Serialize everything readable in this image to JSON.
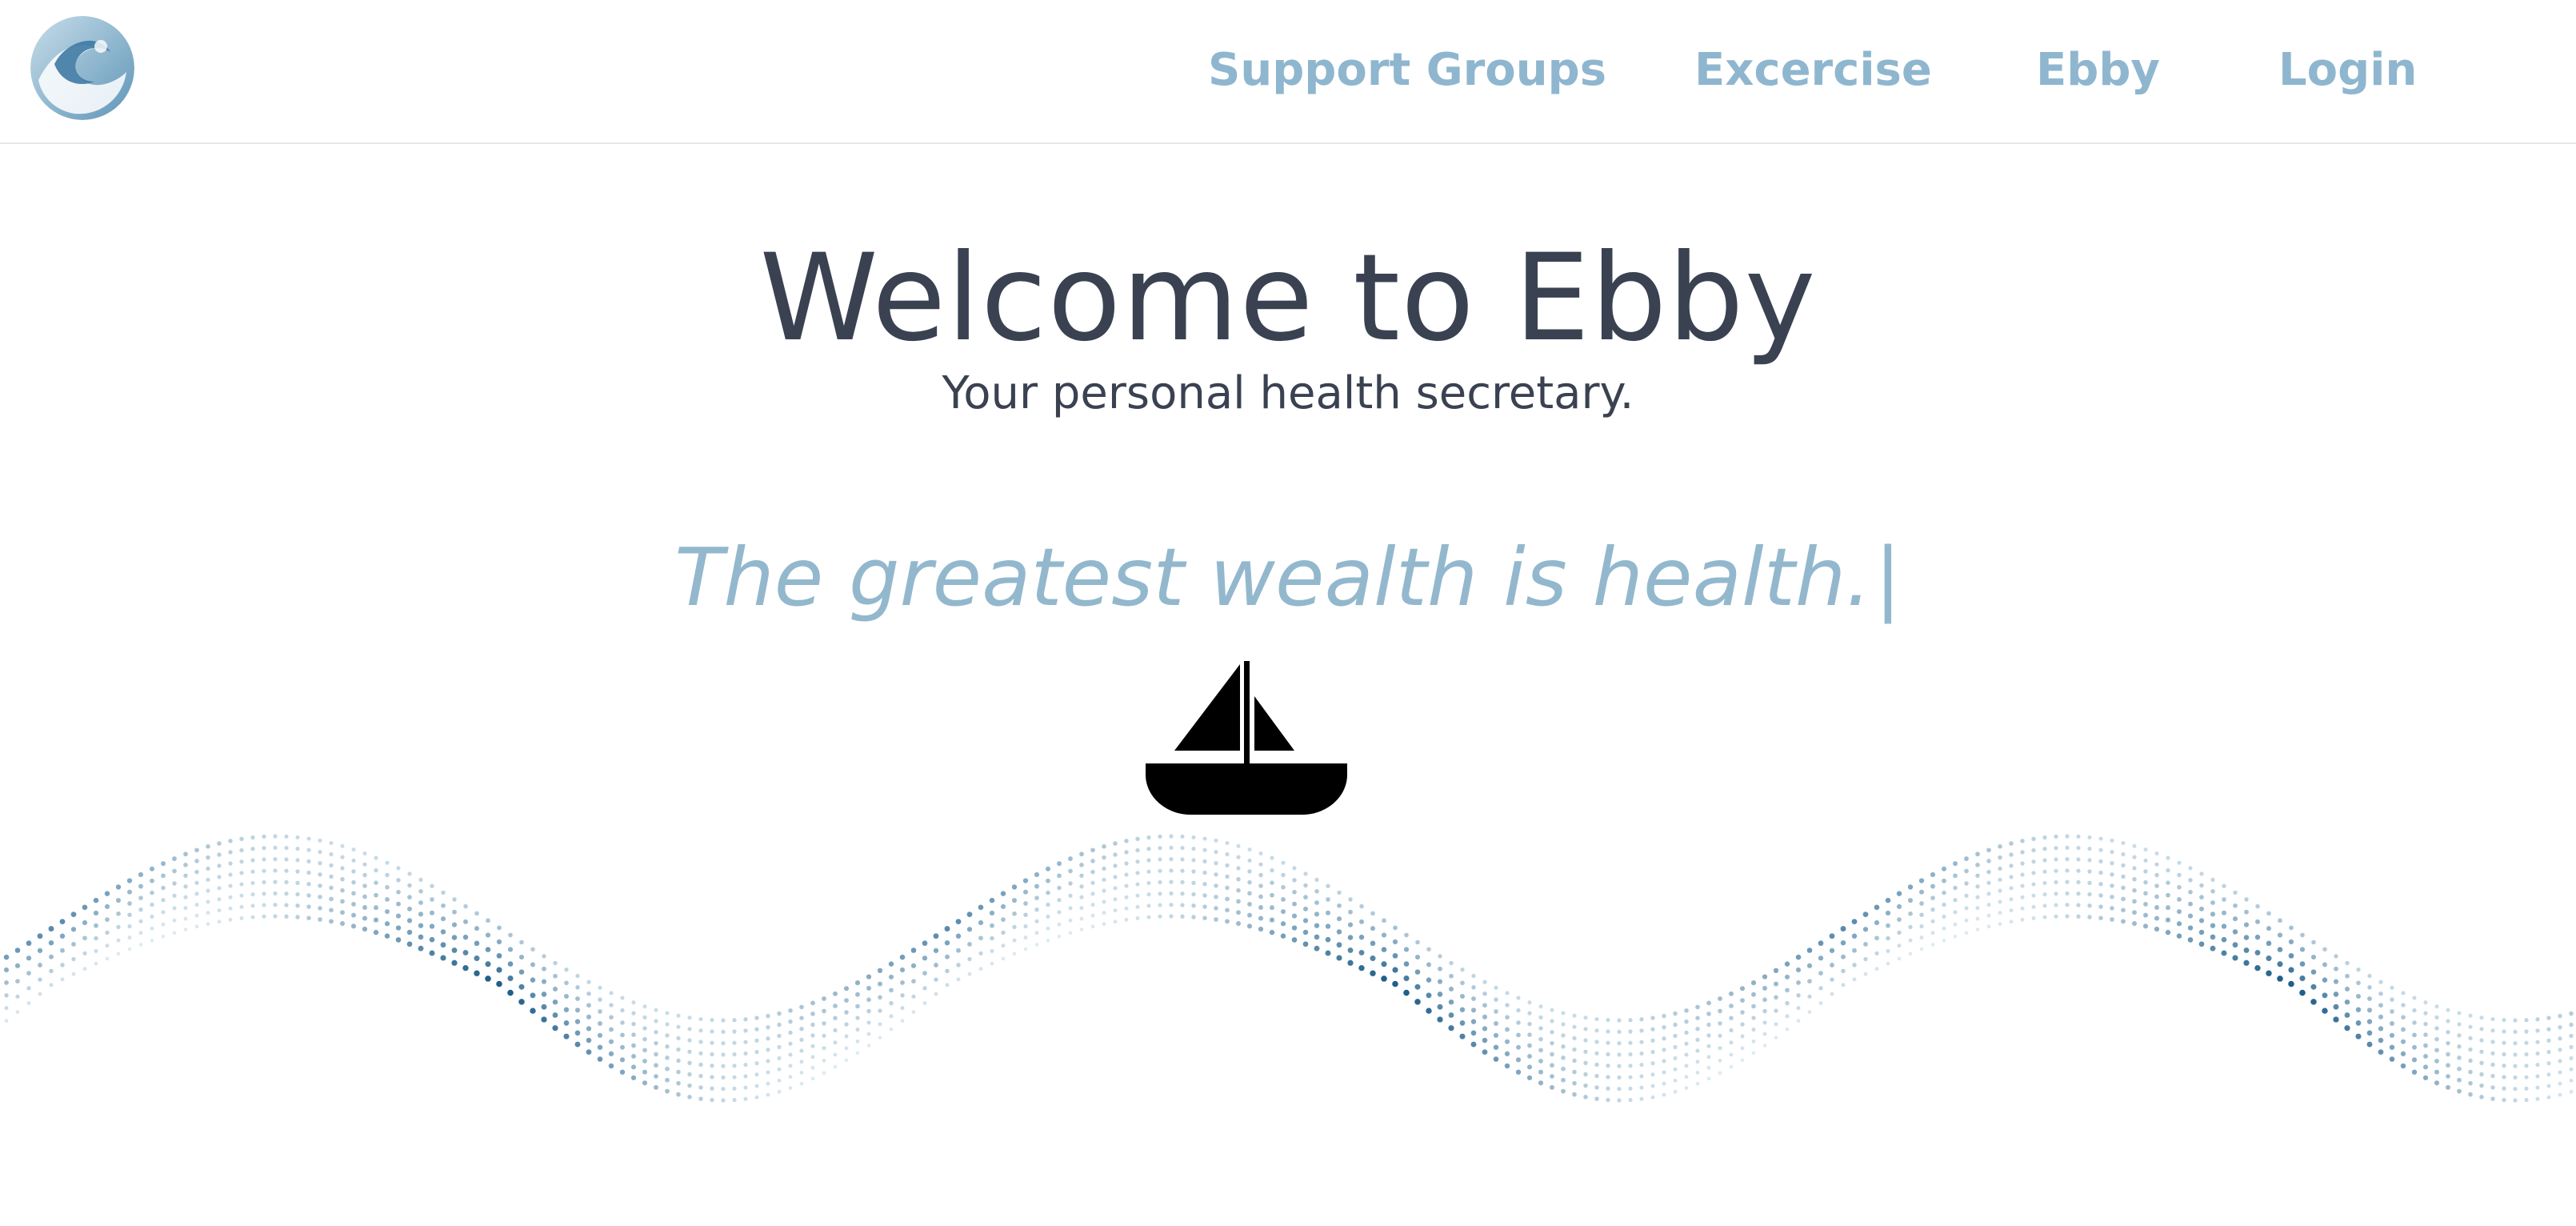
{
  "brand": {
    "logo_icon": "wave-logo-icon",
    "colors": {
      "nav_link": "#8fb6cf",
      "heading": "#3a4252",
      "tagline": "#93b8cd",
      "wave_dark": "#1f5f8a",
      "wave_light": "#cfe3ee",
      "boat": "#000000"
    }
  },
  "nav": {
    "items": [
      {
        "label": "Support Groups"
      },
      {
        "label": "Excercise"
      },
      {
        "label": "Ebby"
      },
      {
        "label": "Login"
      }
    ]
  },
  "hero": {
    "title": "Welcome to Ebby",
    "subtitle": "Your personal health secretary.",
    "tagline": "The greatest wealth is health.",
    "cursor": "|",
    "boat_icon": "sailboat-icon",
    "wave_decoration": "dotted-wave-icon"
  }
}
